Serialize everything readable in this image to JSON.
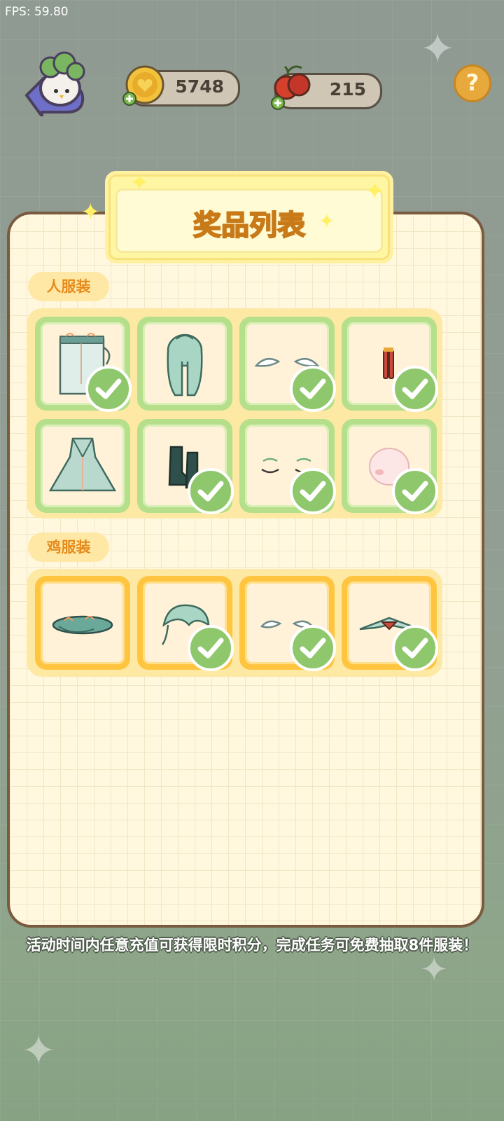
{
  "fps": "FPS: 59.80",
  "currencies": {
    "coins": "5748",
    "cherries": "215"
  },
  "help_label": "?",
  "panel": {
    "title": "奖品列表",
    "human_section": {
      "label": "人服装",
      "items": [
        {
          "icon": "hat-veil-icon",
          "owned": true
        },
        {
          "icon": "long-hair-icon",
          "owned": true
        },
        {
          "icon": "wings-icon",
          "owned": true
        },
        {
          "icon": "earring-icon",
          "owned": true
        },
        {
          "icon": "robe-dress-icon",
          "owned": false
        },
        {
          "icon": "boots-icon",
          "owned": true
        },
        {
          "icon": "closed-eyes-icon",
          "owned": true
        },
        {
          "icon": "blush-face-icon",
          "owned": true
        }
      ]
    },
    "chicken_section": {
      "label": "鸡服装",
      "items": [
        {
          "icon": "chicken-hat-icon",
          "owned": false
        },
        {
          "icon": "chicken-hair-icon",
          "owned": true
        },
        {
          "icon": "chicken-wings-icon",
          "owned": true
        },
        {
          "icon": "chicken-mustache-icon",
          "owned": true
        }
      ]
    }
  },
  "footer_note": "活动时间内任意充值可获得限时积分，完成任务可免费抽取8件服装！",
  "colors": {
    "panel_bg": "#fff8df",
    "green_frame": "#b5df8b",
    "orange_frame": "#ffc540",
    "title_text": "#f0a622",
    "check": "#8fc86c"
  }
}
